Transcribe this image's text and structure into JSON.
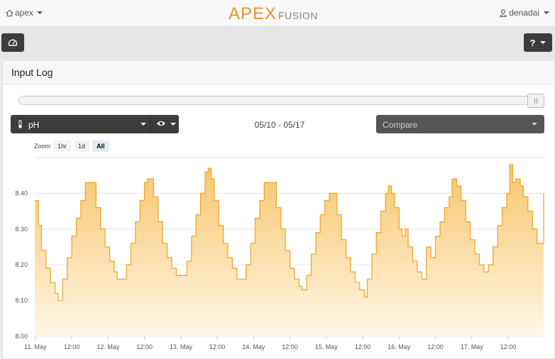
{
  "header": {
    "home_label": "apex",
    "logo_main": "APEX",
    "logo_sub": "FUSION",
    "user": "denadai"
  },
  "panel": {
    "title": "Input Log"
  },
  "selector": {
    "input_label": "pH",
    "date_range": "05/10 - 05/17",
    "compare_placeholder": "Compare"
  },
  "zoom": {
    "label": "Zoom",
    "options": [
      "1hr",
      "1d",
      "All"
    ],
    "active": "All"
  },
  "colors": {
    "accent": "#f0a830",
    "fill_top": "#f7c66b",
    "fill_bottom": "#fff6e6"
  },
  "chart_data": {
    "type": "area",
    "y_ticks": [
      "8.00",
      "8.10",
      "8.20",
      "8.30",
      "8.40"
    ],
    "ylim": [
      8.0,
      8.5
    ],
    "x_ticks": [
      "11. May",
      "12:00",
      "12. May",
      "12:00",
      "13. May",
      "12:00",
      "14. May",
      "12:00",
      "15. May",
      "12:00",
      "16. May",
      "12:00",
      "17. May",
      "12:00"
    ],
    "x_tick_hours": [
      0,
      12,
      24,
      36,
      48,
      60,
      72,
      84,
      96,
      108,
      120,
      132,
      144,
      156
    ],
    "xlim_hours": [
      -0.2,
      167.7
    ],
    "series": [
      {
        "points": [
          [
            -0.2,
            8.38
          ],
          [
            1.0,
            8.31
          ],
          [
            2.0,
            8.24
          ],
          [
            3.5,
            8.19
          ],
          [
            5.0,
            8.15
          ],
          [
            6.5,
            8.12
          ],
          [
            7.5,
            8.1
          ],
          [
            9.0,
            8.16
          ],
          [
            10.5,
            8.22
          ],
          [
            12.0,
            8.28
          ],
          [
            13.5,
            8.33
          ],
          [
            15.0,
            8.38
          ],
          [
            16.5,
            8.43
          ],
          [
            18.5,
            8.43
          ],
          [
            20.0,
            8.36
          ],
          [
            21.5,
            8.3
          ],
          [
            23.0,
            8.25
          ],
          [
            24.5,
            8.21
          ],
          [
            26.0,
            8.18
          ],
          [
            27.0,
            8.16
          ],
          [
            28.5,
            8.16
          ],
          [
            30.0,
            8.2
          ],
          [
            31.5,
            8.26
          ],
          [
            33.0,
            8.32
          ],
          [
            34.5,
            8.38
          ],
          [
            36.0,
            8.43
          ],
          [
            37.0,
            8.44
          ],
          [
            38.0,
            8.44
          ],
          [
            39.0,
            8.39
          ],
          [
            40.5,
            8.32
          ],
          [
            42.0,
            8.26
          ],
          [
            43.5,
            8.22
          ],
          [
            45.0,
            8.19
          ],
          [
            46.5,
            8.17
          ],
          [
            48.5,
            8.17
          ],
          [
            50.0,
            8.21
          ],
          [
            51.5,
            8.28
          ],
          [
            53.0,
            8.34
          ],
          [
            54.5,
            8.4
          ],
          [
            56.0,
            8.46
          ],
          [
            57.0,
            8.47
          ],
          [
            58.0,
            8.44
          ],
          [
            59.0,
            8.38
          ],
          [
            60.5,
            8.31
          ],
          [
            62.0,
            8.26
          ],
          [
            63.5,
            8.22
          ],
          [
            65.0,
            8.19
          ],
          [
            66.5,
            8.16
          ],
          [
            68.0,
            8.16
          ],
          [
            69.5,
            8.2
          ],
          [
            71.0,
            8.26
          ],
          [
            72.5,
            8.33
          ],
          [
            74.0,
            8.38
          ],
          [
            75.5,
            8.43
          ],
          [
            78.0,
            8.43
          ],
          [
            79.5,
            8.36
          ],
          [
            81.0,
            8.3
          ],
          [
            82.5,
            8.24
          ],
          [
            84.0,
            8.19
          ],
          [
            85.5,
            8.16
          ],
          [
            87.0,
            8.14
          ],
          [
            88.0,
            8.13
          ],
          [
            89.5,
            8.17
          ],
          [
            91.0,
            8.23
          ],
          [
            92.5,
            8.29
          ],
          [
            94.0,
            8.34
          ],
          [
            95.5,
            8.38
          ],
          [
            97.0,
            8.4
          ],
          [
            98.5,
            8.4
          ],
          [
            99.5,
            8.34
          ],
          [
            101.0,
            8.27
          ],
          [
            102.5,
            8.22
          ],
          [
            104.0,
            8.18
          ],
          [
            105.5,
            8.15
          ],
          [
            107.0,
            8.13
          ],
          [
            108.5,
            8.11
          ],
          [
            109.5,
            8.16
          ],
          [
            111.0,
            8.23
          ],
          [
            112.5,
            8.29
          ],
          [
            114.0,
            8.35
          ],
          [
            115.5,
            8.4
          ],
          [
            116.5,
            8.42
          ],
          [
            117.5,
            8.4
          ],
          [
            118.5,
            8.36
          ],
          [
            120.0,
            8.3
          ],
          [
            121.0,
            8.28
          ],
          [
            122.0,
            8.3
          ],
          [
            123.0,
            8.25
          ],
          [
            124.5,
            8.21
          ],
          [
            126.0,
            8.18
          ],
          [
            127.5,
            8.16
          ],
          [
            128.5,
            8.16
          ],
          [
            129.0,
            8.25
          ],
          [
            130.5,
            8.22
          ],
          [
            132.0,
            8.28
          ],
          [
            133.5,
            8.32
          ],
          [
            135.0,
            8.36
          ],
          [
            136.5,
            8.39
          ],
          [
            137.5,
            8.44
          ],
          [
            139.0,
            8.42
          ],
          [
            140.5,
            8.38
          ],
          [
            142.0,
            8.32
          ],
          [
            143.5,
            8.27
          ],
          [
            145.0,
            8.23
          ],
          [
            146.5,
            8.2
          ],
          [
            148.0,
            8.18
          ],
          [
            149.5,
            8.2
          ],
          [
            151.0,
            8.25
          ],
          [
            152.5,
            8.31
          ],
          [
            154.0,
            8.36
          ],
          [
            155.5,
            8.4
          ],
          [
            156.5,
            8.48
          ],
          [
            157.5,
            8.43
          ],
          [
            158.5,
            8.44
          ],
          [
            160.0,
            8.42
          ],
          [
            161.0,
            8.39
          ],
          [
            162.5,
            8.35
          ],
          [
            164.0,
            8.3
          ],
          [
            165.5,
            8.26
          ],
          [
            166.5,
            8.26
          ],
          [
            167.7,
            8.4
          ]
        ]
      }
    ]
  }
}
